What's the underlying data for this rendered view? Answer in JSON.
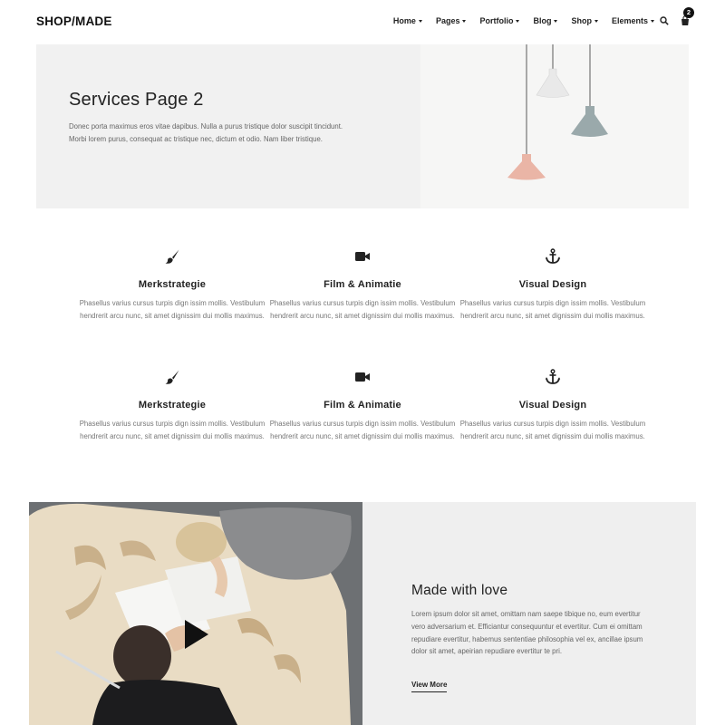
{
  "header": {
    "logo": "SHOP/MADE",
    "nav": [
      "Home",
      "Pages",
      "Portfolio",
      "Blog",
      "Shop",
      "Elements"
    ],
    "cart_count": "2",
    "icons": [
      "search-icon",
      "cart-icon"
    ]
  },
  "hero": {
    "title": "Services Page 2",
    "text": "Donec porta maximus eros vitae dapibus. Nulla a purus tristique dolor suscipit tincidunt. Morbi lorem purus, consequat ac tristique nec, dictum et odio. Nam liber tristique."
  },
  "services": [
    {
      "icon": "brush-icon",
      "title": "Merkstrategie",
      "text": "Phasellus varius cursus turpis dign issim mollis. Vestibulum hendrerit arcu nunc, sit amet dignissim dui mollis maximus."
    },
    {
      "icon": "video-camera-icon",
      "title": "Film & Animatie",
      "text": "Phasellus varius cursus turpis dign issim mollis. Vestibulum hendrerit arcu nunc, sit amet dignissim dui mollis maximus."
    },
    {
      "icon": "anchor-icon",
      "title": "Visual Design",
      "text": "Phasellus varius cursus turpis dign issim mollis. Vestibulum hendrerit arcu nunc, sit amet dignissim dui mollis maximus."
    },
    {
      "icon": "brush-icon",
      "title": "Merkstrategie",
      "text": "Phasellus varius cursus turpis dign issim mollis. Vestibulum hendrerit arcu nunc, sit amet dignissim dui mollis maximus."
    },
    {
      "icon": "video-camera-icon",
      "title": "Film & Animatie",
      "text": "Phasellus varius cursus turpis dign issim mollis. Vestibulum hendrerit arcu nunc, sit amet dignissim dui mollis maximus."
    },
    {
      "icon": "anchor-icon",
      "title": "Visual Design",
      "text": "Phasellus varius cursus turpis dign issim mollis. Vestibulum hendrerit arcu nunc, sit amet dignissim dui mollis maximus."
    }
  ],
  "feature": {
    "title": "Made with love",
    "text": "Lorem ipsum dolor sit amet, omittam nam saepe tibique no, eum evertitur vero adversarium et. Efficiantur consequuntur et evertitur. Cum ei omittam repudiare evertitur, habemus sententiae philosophia vel ex, ancillae ipsum dolor sit amet, apeirian repudiare evertitur te pri.",
    "link": "View More"
  },
  "colors": {
    "hero_bg": "#f1f1f1",
    "feature_bg": "#efefef",
    "lamp_white": "#e9e9e9",
    "lamp_blue": "#9aa9ab",
    "lamp_pink": "#eab5a6"
  }
}
